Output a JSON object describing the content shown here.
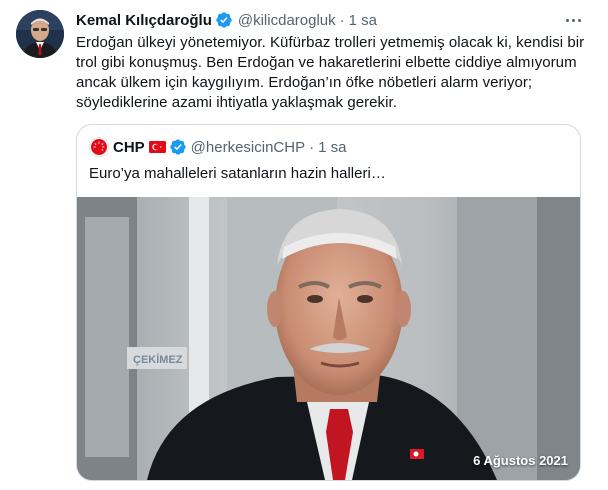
{
  "tweet": {
    "author_name": "Kemal Kılıçdaroğlu",
    "handle": "@kilicdarogluk",
    "separator": "·",
    "time": "1 sa",
    "text": "Erdoğan ülkeyi yönetemiyor. Küfürbaz trolleri yetmemiş olacak ki, kendisi bir trol gibi konuşmuş. Ben Erdoğan ve hakaretlerini elbette ciddiye almıyorum ancak ülkem için kaygılıyım. Erdoğan’ın öfke nöbetleri alarm veriyor; söylediklerine azami ihtiyatla yaklaşmak gerekir."
  },
  "quoted_tweet": {
    "author_name": "CHP",
    "handle": "@herkesicinCHP",
    "separator": "·",
    "time": "1 sa",
    "text": "Euro’ya mahalleleri satanların hazin halleri…",
    "media": {
      "date_overlay": "6 Ağustos 2021",
      "sign_text": "ÇEKİMEZ"
    }
  },
  "colors": {
    "verified": "#1d9bf0",
    "text_primary": "#0f1419",
    "text_secondary": "#536471",
    "border": "#cfd9de",
    "chp_red": "#e30a17"
  },
  "icons": {
    "verified": "verified-badge-icon",
    "more": "more-options-icon",
    "flag": "turkey-flag-icon"
  }
}
